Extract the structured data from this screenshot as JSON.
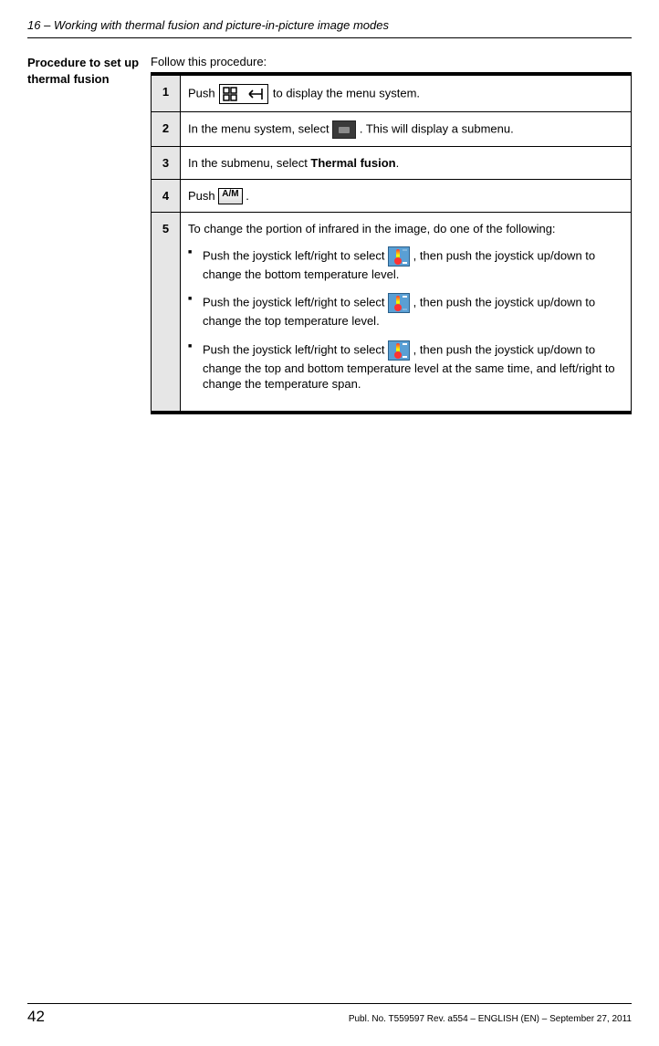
{
  "header": "16 – Working with thermal fusion and picture-in-picture image modes",
  "sidebar": {
    "title": "Procedure to set up thermal fusion"
  },
  "intro": "Follow this procedure:",
  "steps": {
    "s1": {
      "num": "1",
      "a": "Push ",
      "b": " to display the menu system."
    },
    "s2": {
      "num": "2",
      "a": "In the menu system, select ",
      "b": ". This will display a submenu."
    },
    "s3": {
      "num": "3",
      "a": "In the submenu, select ",
      "bold": "Thermal fusion",
      "b": "."
    },
    "s4": {
      "num": "4",
      "a": "Push ",
      "b": "."
    },
    "s5": {
      "num": "5",
      "lead": "To change the portion of infrared in the image, do one of the following:",
      "b1a": "Push the joystick left/right to select ",
      "b1b": ", then push the joystick up/down to change the bottom temperature level.",
      "b2a": "Push the joystick left/right to select ",
      "b2b": ", then push the joystick up/down to change the top temperature level.",
      "b3a": "Push the joystick left/right to select ",
      "b3b": ", then push the joystick up/down to change the top and bottom temperature level at the same time, and left/right to change the temperature span."
    }
  },
  "footer": {
    "page": "42",
    "pub": "Publ. No. T559597 Rev. a554 – ENGLISH (EN) – September 27, 2011"
  },
  "icons": {
    "am_label": "A/M"
  }
}
